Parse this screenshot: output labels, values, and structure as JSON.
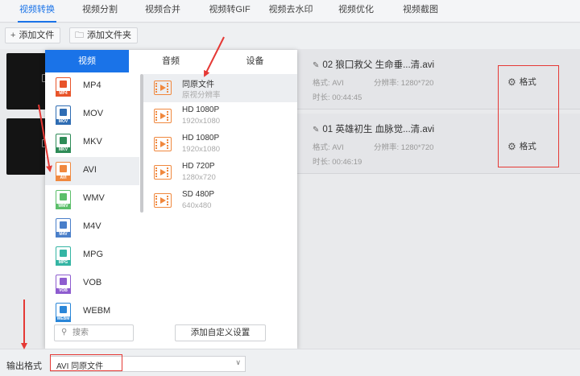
{
  "nav": {
    "tabs": [
      {
        "label": "视频转换",
        "active": true
      },
      {
        "label": "视频分割"
      },
      {
        "label": "视频合并"
      },
      {
        "label": "视频转GIF"
      },
      {
        "label": "视频去水印"
      },
      {
        "label": "视频优化"
      },
      {
        "label": "视频截图"
      }
    ]
  },
  "toolbar": {
    "add_file_label": "添加文件",
    "add_folder_label": "添加文件夹"
  },
  "files": [
    {
      "name": "02 狼囗救父 生命垂...清.avi",
      "format_label": "格式:",
      "format_value": "AVI",
      "resolution_label": "分辨率:",
      "resolution_value": "1280*720",
      "duration_label": "时长:",
      "duration_value": "00:44:45",
      "format_button": "格式"
    },
    {
      "name": "01 英雄初生 血脉觉...清.avi",
      "format_label": "格式:",
      "format_value": "AVI",
      "resolution_label": "分辨率:",
      "resolution_value": "1280*720",
      "duration_label": "时长:",
      "duration_value": "00:46:19",
      "format_button": "格式"
    }
  ],
  "popup": {
    "tabs": [
      {
        "label": "视频",
        "active": true
      },
      {
        "label": "音频"
      },
      {
        "label": "设备"
      }
    ],
    "formats": [
      {
        "label": "MP4",
        "color": "#e8542a",
        "band": "MP4"
      },
      {
        "label": "MOV",
        "color": "#2f6db3",
        "band": "MOV"
      },
      {
        "label": "MKV",
        "color": "#2e8b57",
        "band": "MKV"
      },
      {
        "label": "AVI",
        "color": "#f0883e",
        "band": "AVI",
        "active": true
      },
      {
        "label": "WMV",
        "color": "#5cbf6a",
        "band": "WMV"
      },
      {
        "label": "M4V",
        "color": "#4a7fc9",
        "band": "M4V"
      },
      {
        "label": "MPG",
        "color": "#35b5a4",
        "band": "MPG"
      },
      {
        "label": "VOB",
        "color": "#8e5ccf",
        "band": "VOB"
      },
      {
        "label": "WEBM",
        "color": "#2a86d8",
        "band": "WEBM"
      }
    ],
    "presets": [
      {
        "title": "同原文件",
        "subtitle": "原视分辨率",
        "active": true
      },
      {
        "title": "HD 1080P",
        "subtitle": "1920x1080"
      },
      {
        "title": "HD 1080P",
        "subtitle": "1920x1080"
      },
      {
        "title": "HD 720P",
        "subtitle": "1280x720"
      },
      {
        "title": "SD 480P",
        "subtitle": "640x480"
      }
    ],
    "search_placeholder": "搜索",
    "custom_button": "添加自定义设置"
  },
  "output": {
    "label": "输出格式",
    "value": "AVI  同原文件"
  },
  "colors": {
    "accent": "#1a73e8",
    "annotation": "#e53935",
    "preset_icon": "#f0883e"
  }
}
